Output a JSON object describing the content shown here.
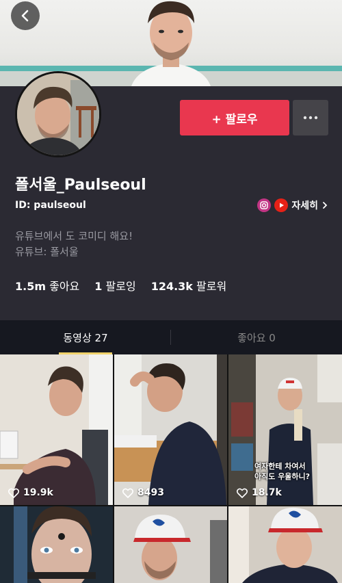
{
  "header": {
    "back_icon": "chevron-left-icon"
  },
  "profile": {
    "follow_label": "+ 팔로우",
    "more_icon": "more-dots-icon",
    "display_name": "폴서울_Paulseoul",
    "user_id": "ID: paulseoul",
    "details_label": "자세히",
    "bio_line1": "유튜브에서 도 코미디 해요!",
    "bio_line2": "유튜브: 폴서울",
    "stats": {
      "likes_value": "1.5m",
      "likes_label": "좋아요",
      "following_value": "1",
      "following_label": "팔로잉",
      "followers_value": "124.3k",
      "followers_label": "팔로워"
    },
    "colors": {
      "follow": "#e9374f",
      "instagram": "#c13584",
      "youtube": "#e62117",
      "tab_indicator": "#f0d26a"
    }
  },
  "tabs": [
    {
      "label": "동영상 27"
    },
    {
      "label": "좋아요 0"
    }
  ],
  "videos": [
    {
      "likes": "19.9k"
    },
    {
      "likes": "8493"
    },
    {
      "likes": "18.7k",
      "caption_line1": "여자한테 차여서",
      "caption_line2": "아직도 우울하니?"
    },
    {
      "likes": ""
    },
    {
      "likes": ""
    },
    {
      "likes": ""
    }
  ]
}
